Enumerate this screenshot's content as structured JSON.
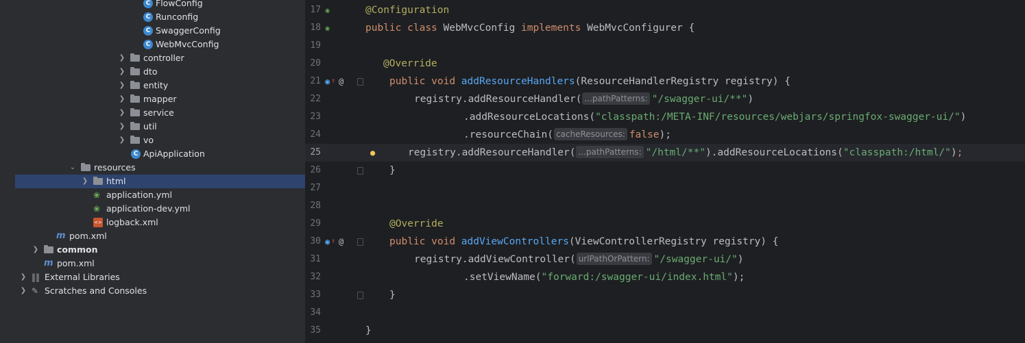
{
  "project_tree": {
    "rows": [
      {
        "label": "FlowConfig",
        "icon": "class-icon"
      },
      {
        "label": "Runconfig",
        "icon": "class-icon"
      },
      {
        "label": "SwaggerConfig",
        "icon": "class-icon"
      },
      {
        "label": "WebMvcConfig",
        "icon": "class-icon"
      },
      {
        "label": "controller",
        "icon": "folder-icon"
      },
      {
        "label": "dto",
        "icon": "folder-icon"
      },
      {
        "label": "entity",
        "icon": "folder-icon"
      },
      {
        "label": "mapper",
        "icon": "folder-icon"
      },
      {
        "label": "service",
        "icon": "folder-icon"
      },
      {
        "label": "util",
        "icon": "folder-icon"
      },
      {
        "label": "vo",
        "icon": "folder-icon"
      },
      {
        "label": "ApiApplication",
        "icon": "spring-boot-class-icon"
      },
      {
        "label": "resources",
        "icon": "resources-folder-icon"
      },
      {
        "label": "html",
        "icon": "folder-icon"
      },
      {
        "label": "application.yml",
        "icon": "spring-yaml-icon"
      },
      {
        "label": "application-dev.yml",
        "icon": "spring-yaml-icon"
      },
      {
        "label": "logback.xml",
        "icon": "xml-icon"
      },
      {
        "label": "pom.xml",
        "icon": "maven-icon"
      },
      {
        "label": "common",
        "icon": "module-folder-icon"
      },
      {
        "label": "pom.xml",
        "icon": "maven-icon"
      },
      {
        "label": "External Libraries",
        "icon": "libraries-icon"
      },
      {
        "label": "Scratches and Consoles",
        "icon": "scratches-icon"
      }
    ]
  },
  "editor": {
    "line_numbers": [
      "17",
      "18",
      "19",
      "20",
      "21",
      "22",
      "23",
      "24",
      "25",
      "26",
      "27",
      "28",
      "29",
      "30",
      "31",
      "32",
      "33",
      "34",
      "35"
    ],
    "current_line": "25",
    "tokens": {
      "l17_ann": "@Configuration",
      "l18_public": "public",
      "l18_class": "class",
      "l18_name": "WebMvcConfig",
      "l18_implements": "implements",
      "l18_rest": "WebMvcConfigurer {",
      "l20_ann": "@Override",
      "l21_public": "public",
      "l21_void": "void",
      "l21_fn": "addResourceHandlers",
      "l21_rest": "(ResourceHandlerRegistry registry) {",
      "l22_a": "registry.addResourceHandler(",
      "l22_hint": "...pathPatterns:",
      "l22_str": "\"/swagger-ui/**\"",
      "l22_b": ")",
      "l23_a": ".addResourceLocations(",
      "l23_str": "\"classpath:/META-INF/resources/webjars/springfox-swagger-ui/\"",
      "l23_b": ")",
      "l24_a": ".resourceChain(",
      "l24_hint": "cacheResources:",
      "l24_kw": "false",
      "l24_b": ");",
      "l25_a": "registry.addResourceHandler(",
      "l25_hint": "...pathPatterns:",
      "l25_str": "\"/html/**\"",
      "l25_b": ").addResourceLocations(",
      "l25_str2": "\"classpath:/html/\"",
      "l25_c": ")",
      "l25_semi": ";",
      "l26": "}",
      "l29_ann": "@Override",
      "l30_public": "public",
      "l30_void": "void",
      "l30_fn": "addViewControllers",
      "l30_rest": "(ViewControllerRegistry registry) {",
      "l31_a": "registry.addViewController(",
      "l31_hint": "urlPathOrPattern:",
      "l31_str": "\"/swagger-ui/\"",
      "l31_b": ")",
      "l32_a": ".setViewName(",
      "l32_str": "\"forward:/swagger-ui/index.html\"",
      "l32_b": ");",
      "l33": "}",
      "l35": "}"
    }
  },
  "colors": {
    "keyword": "#cf8e6d",
    "annotation": "#b3ae60",
    "method": "#56a8f5",
    "string": "#6aab73",
    "selection": "#2e436e"
  }
}
